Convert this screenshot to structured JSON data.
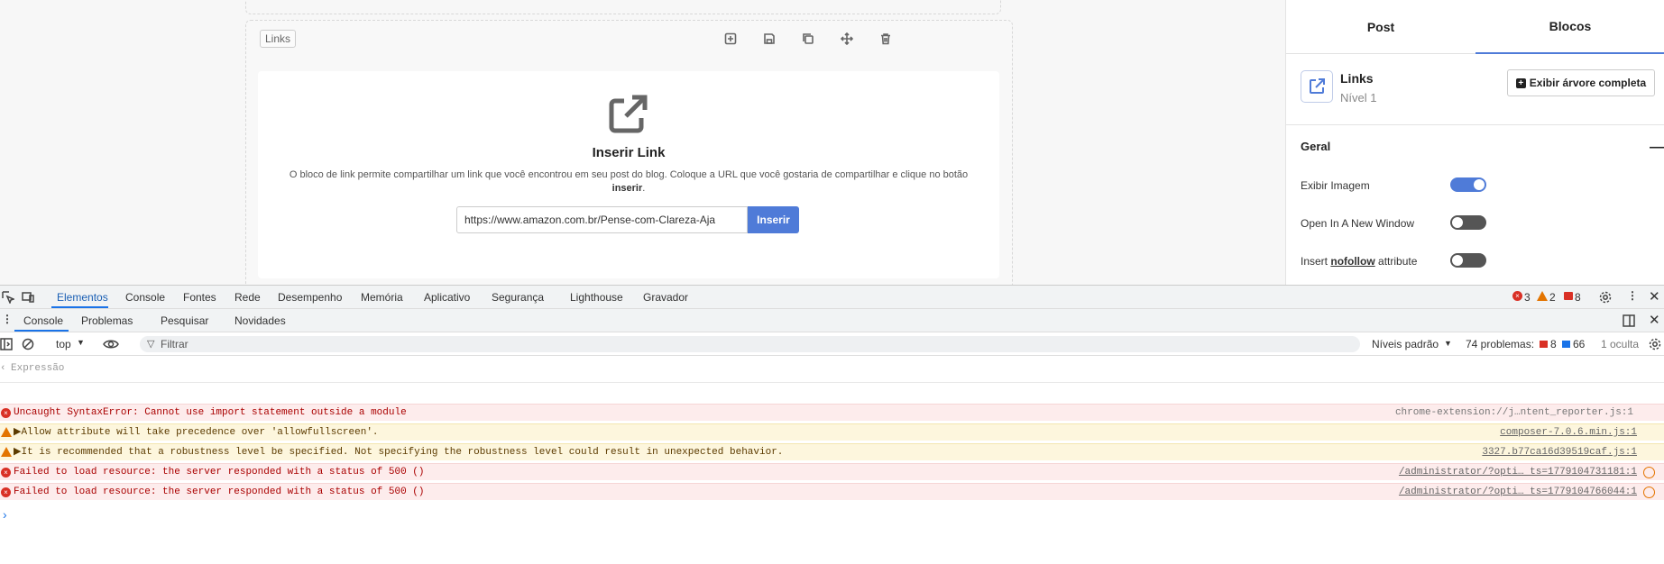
{
  "block": {
    "tag": "Links",
    "title": "Inserir Link",
    "desc_1": "O bloco de link permite compartilhar um link que você encontrou em seu post do blog. Coloque a URL que você gostaria de compartilhar e clique no botão ",
    "desc_bold": "inserir",
    "desc_end": ".",
    "url_value": "https://www.amazon.com.br/Pense-com-Clareza-Aja",
    "insert_label": "Inserir"
  },
  "panel": {
    "tabs": [
      "Post",
      "Blocos"
    ],
    "active_tab": "Blocos",
    "block_name": "Links",
    "block_level": "Nível 1",
    "tree_button": "Exibir árvore completa",
    "section": "Geral",
    "options": [
      {
        "label": "Exibir Imagem",
        "on": true
      },
      {
        "label": "Open In A New Window",
        "on": false
      },
      {
        "label_pre": "Insert ",
        "label_bold": "nofollow",
        "label_post": " attribute",
        "on": false
      }
    ],
    "accent": "#4f7bd8"
  },
  "devtools": {
    "tabs": [
      "Elementos",
      "Console",
      "Fontes",
      "Rede",
      "Desempenho",
      "Memória",
      "Aplicativo",
      "Segurança",
      "Lighthouse",
      "Gravador"
    ],
    "active_tab": "Elementos",
    "counts": {
      "errors": "3",
      "warnings": "2",
      "issues": "8"
    },
    "drawer_tabs": [
      "Console",
      "Problemas",
      "Pesquisar",
      "Novidades"
    ],
    "context": "top",
    "filter_placeholder": "Filtrar",
    "levels": "Níveis padrão",
    "problems_label": "74 problemas:",
    "problems_err": "8",
    "problems_info": "66",
    "hidden": "1 oculta",
    "expression_placeholder": "Expressão",
    "messages": [
      {
        "type": "error",
        "text": "Uncaught SyntaxError: Cannot use import statement outside a module",
        "source": "chrome-extension://j…ntent_reporter.js:1"
      },
      {
        "type": "warning",
        "text": "▶Allow attribute will take precedence over 'allowfullscreen'.",
        "source": "composer-7.0.6.min.js:1"
      },
      {
        "type": "warning",
        "text": "▶It is recommended that a robustness level be specified. Not specifying the robustness level could result in unexpected behavior.",
        "source": "3327.b77ca16d39519caf.js:1"
      },
      {
        "type": "error",
        "text": "Failed to load resource: the server responded with a status of 500 ()",
        "source": "/administrator/?opti… ts=1779104731181:1"
      },
      {
        "type": "error",
        "text": "Failed to load resource: the server responded with a status of 500 ()",
        "source": "/administrator/?opti… ts=1779104766044:1"
      }
    ]
  }
}
